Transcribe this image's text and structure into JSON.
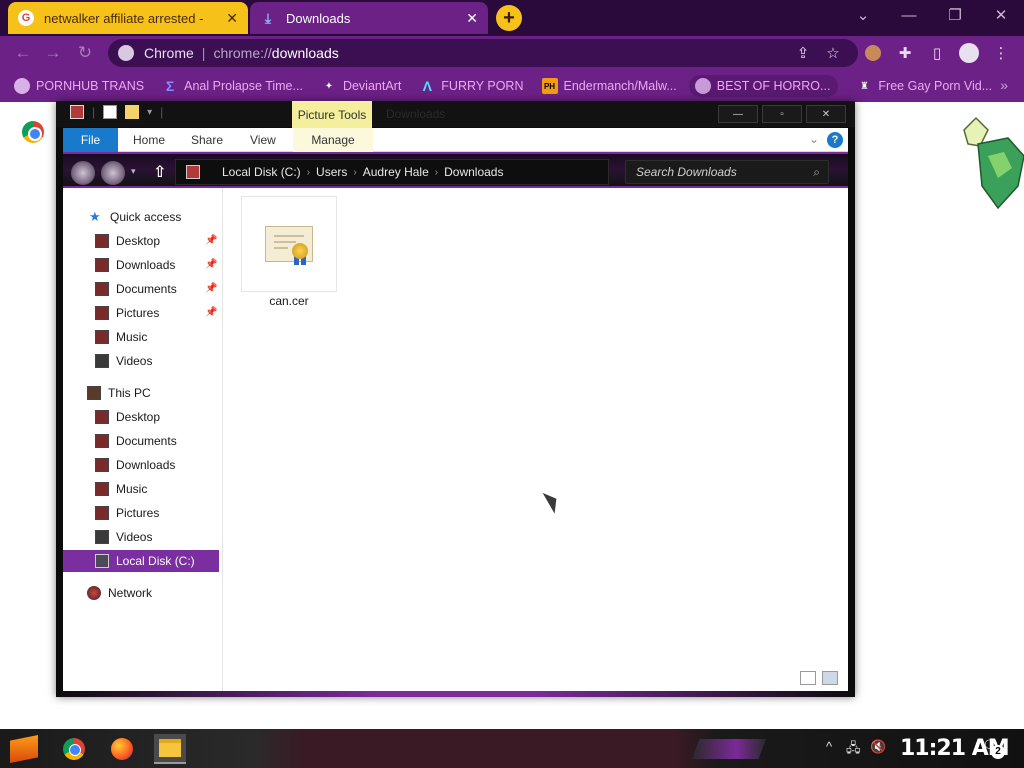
{
  "browser": {
    "tabs": [
      {
        "title": "netwalker affiliate arrested - ",
        "favicon": "G",
        "close": "✕"
      },
      {
        "title": "Downloads",
        "favicon": "download-icon",
        "close": "✕"
      }
    ],
    "new_tab": "+",
    "window_controls": [
      "⌄",
      "—",
      "❐",
      "✕"
    ],
    "omnibox": {
      "site_label": "Chrome",
      "separator": "|",
      "url_scheme": "chrome://",
      "url_path": "downloads"
    },
    "bookmarks": [
      {
        "label": "PORNHUB TRANS",
        "icon": "globe-icon"
      },
      {
        "label": "Anal Prolapse Time...",
        "icon": "sigma-icon"
      },
      {
        "label": "DeviantArt",
        "icon": "deviantart-icon"
      },
      {
        "label": "FURRY PORN",
        "icon": "lambda-icon"
      },
      {
        "label": "Endermanch/Malw...",
        "icon": "ph-icon"
      },
      {
        "label": "BEST OF HORRO...",
        "icon": "globe-icon"
      },
      {
        "label": "Free Gay Porn Vid...",
        "icon": "figure-icon"
      }
    ],
    "bookmarks_more": "»"
  },
  "explorer": {
    "title": "Downloads",
    "context_tab": "Picture Tools",
    "ribbon_tabs": [
      "File",
      "Home",
      "Share",
      "View",
      "Manage"
    ],
    "breadcrumb": [
      "Local Disk (C:)",
      "Users",
      "Audrey Hale",
      "Downloads"
    ],
    "search_placeholder": "Search Downloads",
    "nav": {
      "quick_access": "Quick access",
      "quick_items": [
        "Desktop",
        "Downloads",
        "Documents",
        "Pictures",
        "Music",
        "Videos"
      ],
      "this_pc": "This PC",
      "pc_items": [
        "Desktop",
        "Documents",
        "Downloads",
        "Music",
        "Pictures",
        "Videos"
      ],
      "local_disk": "Local Disk (C:)",
      "network": "Network"
    },
    "files": [
      {
        "name": "can.cer",
        "icon": "certificate-icon"
      }
    ]
  },
  "taskbar": {
    "clock": "11:21 AM",
    "notification_count": "2",
    "tray_icons": [
      "^",
      "network-icon",
      "volume-muted-icon"
    ]
  },
  "colors": {
    "accent_purple": "#6b2186",
    "tab_yellow": "#f6c21a",
    "selection": "#7a2ea0",
    "file_tab": "#1979ca"
  }
}
